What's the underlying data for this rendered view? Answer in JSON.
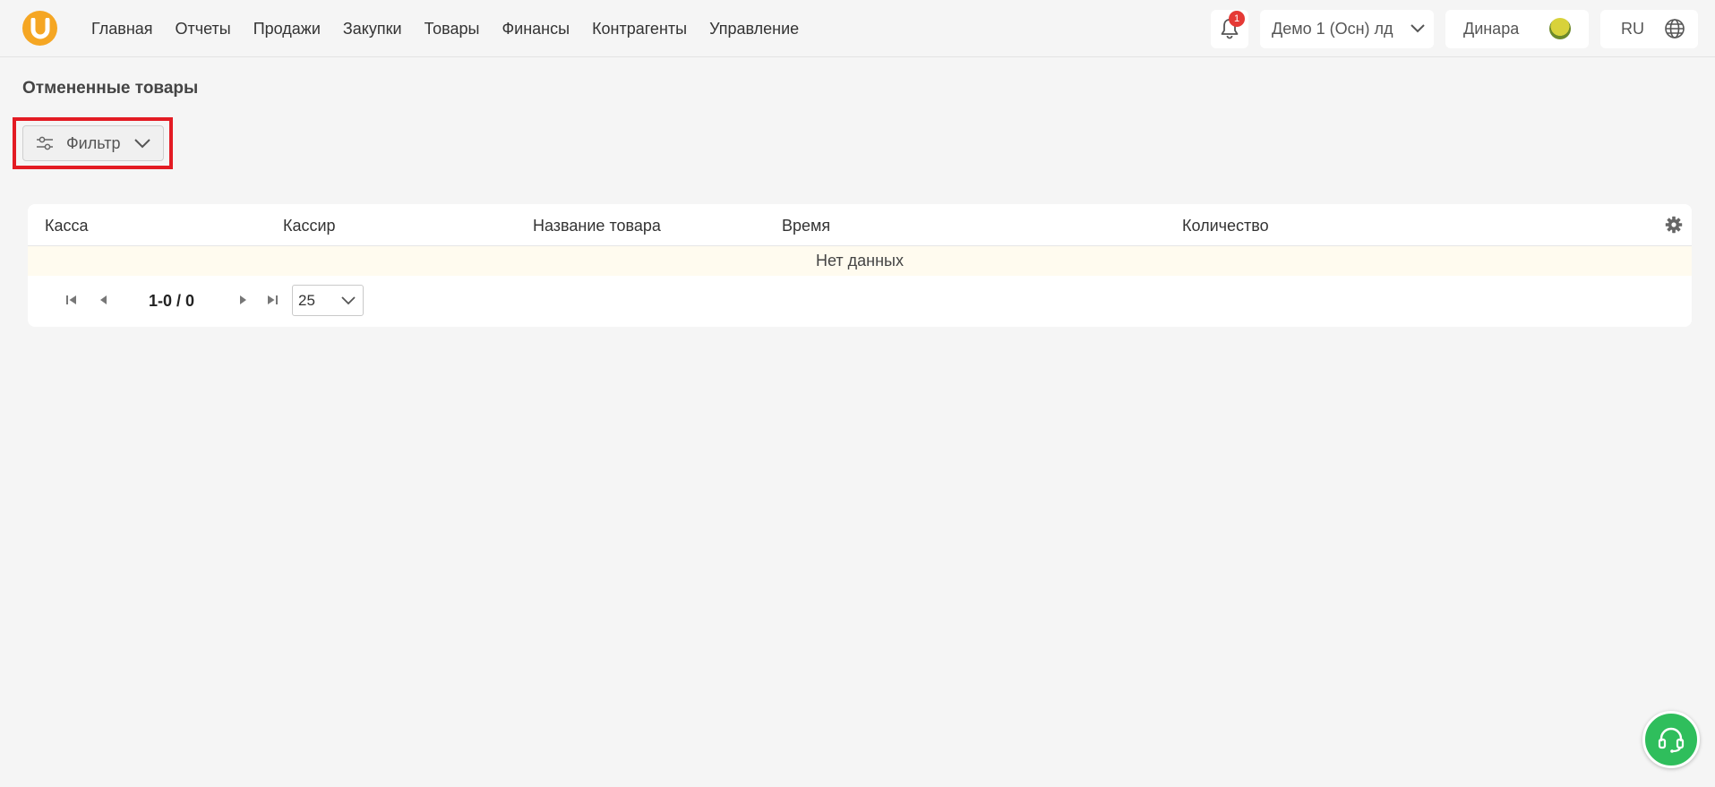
{
  "header": {
    "logo_letter": "U",
    "nav": [
      {
        "label": "Главная"
      },
      {
        "label": "Отчеты"
      },
      {
        "label": "Продажи"
      },
      {
        "label": "Закупки"
      },
      {
        "label": "Товары"
      },
      {
        "label": "Финансы"
      },
      {
        "label": "Контрагенты"
      },
      {
        "label": "Управление"
      }
    ],
    "notifications_count": "1",
    "organization": "Демо 1 (Осн) лд",
    "user_name": "Динара",
    "language": "RU"
  },
  "page": {
    "title": "Отмененные товары",
    "filter_label": "Фильтр"
  },
  "table": {
    "columns": [
      "Касса",
      "Кассир",
      "Название товара",
      "Время",
      "Количество"
    ],
    "empty_text": "Нет данных",
    "pagination": {
      "range": "1-0 / 0",
      "page_size": "25"
    }
  },
  "colors": {
    "brand": "#f5a623",
    "highlight": "#e31b23",
    "badge": "#e53935",
    "support": "#2fbe5c",
    "empty_row": "#fffbef"
  },
  "icons": [
    "bell-icon",
    "chevron-down-icon",
    "globe-icon",
    "sliders-icon",
    "settings-gear-icon",
    "first-page-icon",
    "prev-page-icon",
    "next-page-icon",
    "last-page-icon",
    "headset-icon"
  ]
}
